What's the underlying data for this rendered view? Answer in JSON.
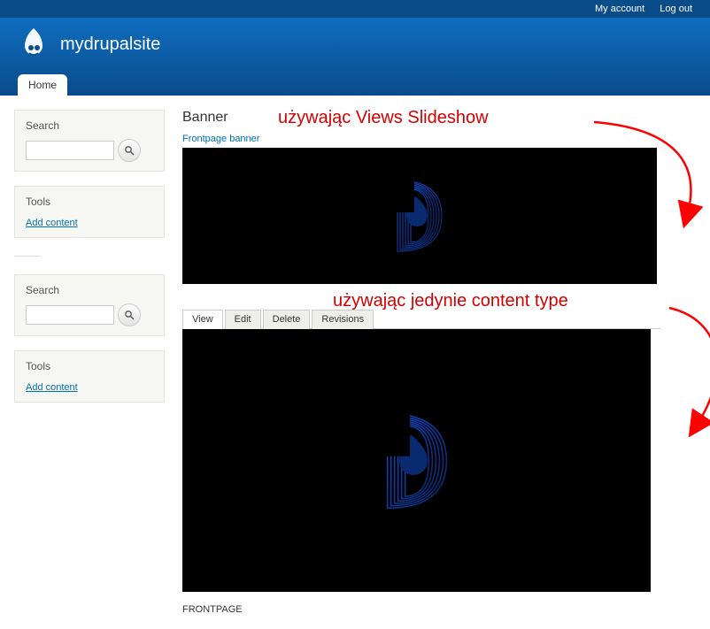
{
  "topbar": {
    "my_account": "My account",
    "log_out": "Log out"
  },
  "site": {
    "name": "mydrupalsite"
  },
  "nav": {
    "home": "Home"
  },
  "sidebar": {
    "search_title": "Search",
    "search_value": "",
    "tools_title": "Tools",
    "add_content": "Add content"
  },
  "content": {
    "banner_title": "Banner",
    "frontpage_banner_link": "Frontpage banner",
    "tabs": {
      "view": "View",
      "edit": "Edit",
      "delete": "Delete",
      "revisions": "Revisions"
    },
    "frontpage_text": "FRONTPAGE"
  },
  "annotations": {
    "top": "używając Views Slideshow",
    "bottom": "używając jedynie content type"
  }
}
